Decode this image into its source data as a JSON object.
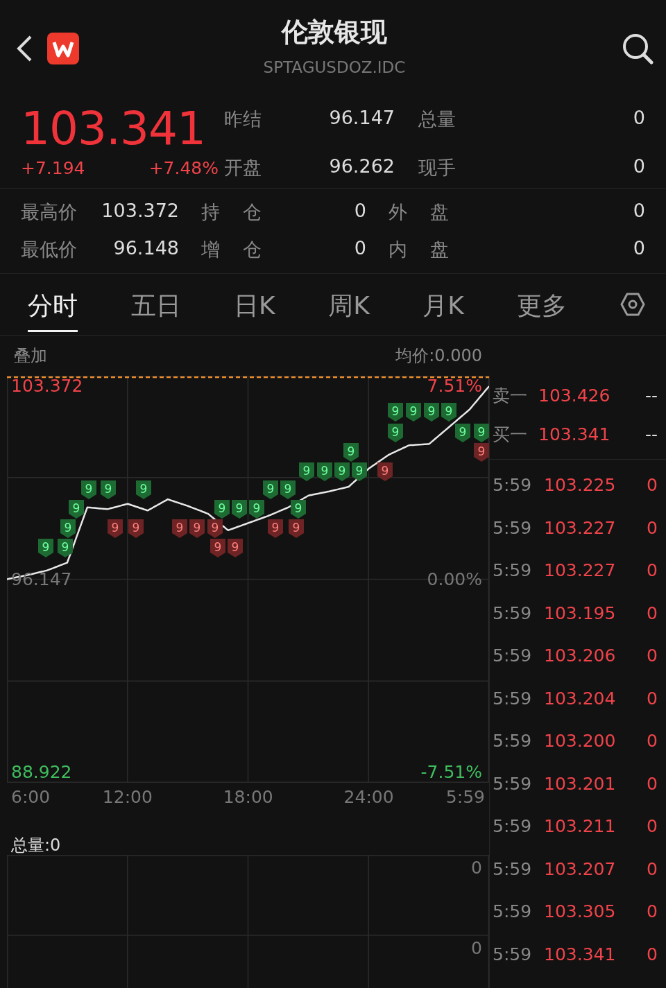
{
  "header": {
    "title": "伦敦银现",
    "code": "SPTAGUSDOZ.IDC"
  },
  "quote": {
    "price": "103.341",
    "change": "+7.194",
    "change_pct": "+7.48%",
    "fields": [
      {
        "label": "昨结",
        "value": "96.147"
      },
      {
        "label": "总量",
        "value": "0"
      },
      {
        "label": "开盘",
        "value": "96.262"
      },
      {
        "label": "现手",
        "value": "0"
      }
    ]
  },
  "stats": [
    {
      "label": "最高价",
      "value": "103.372"
    },
    {
      "label": "持 仓",
      "value": "0"
    },
    {
      "label": "外 盘",
      "value": "0"
    },
    {
      "label": "最低价",
      "value": "96.148"
    },
    {
      "label": "增 仓",
      "value": "0"
    },
    {
      "label": "内 盘",
      "value": "0"
    }
  ],
  "tabs": [
    {
      "label": "分时",
      "selected": true
    },
    {
      "label": "五日",
      "selected": false
    },
    {
      "label": "日K",
      "selected": false
    },
    {
      "label": "周K",
      "selected": false
    },
    {
      "label": "月K",
      "selected": false
    },
    {
      "label": "更多",
      "selected": false
    }
  ],
  "chart": {
    "overlay": "叠加",
    "average": "均价:0.000",
    "top_pct": "7.51%",
    "mid_pct": "0.00%",
    "bottom_pct": "-7.51%",
    "end_time": "5:59",
    "chart_data": {
      "type": "line",
      "x": [
        6,
        7,
        8,
        9,
        10,
        11,
        12,
        13,
        14,
        15,
        16,
        17,
        18,
        19,
        20,
        21,
        22,
        23,
        24,
        25,
        26,
        27,
        28,
        29,
        29.983
      ],
      "series": [
        {
          "color": "#e8e8e8",
          "values": [
            96.15,
            96.3,
            96.48,
            96.77,
            98.84,
            98.77,
            98.97,
            98.72,
            99.14,
            98.89,
            98.6,
            97.98,
            98.25,
            98.52,
            98.84,
            99.28,
            99.43,
            99.61,
            100.29,
            100.81,
            101.16,
            101.21,
            101.85,
            102.49,
            103.37
          ]
        }
      ],
      "ylim": [
        88.533,
        103.761
      ],
      "grid": true,
      "yticks": [
        {
          "value": 88.922,
          "label": "88.922"
        },
        {
          "value": 96.147,
          "label": "96.147"
        },
        {
          "value": 103.372,
          "label": "103.372"
        }
      ],
      "xlim": [
        6,
        29.983
      ],
      "xticks": [
        {
          "value": 6,
          "label": "6:00"
        },
        {
          "value": 12,
          "label": "12:00"
        },
        {
          "value": 18,
          "label": "18:00"
        },
        {
          "value": 24,
          "label": "24:00"
        }
      ]
    },
    "markers": [
      {
        "label": "9",
        "color": "#1d6b32"
      },
      {
        "label": "9",
        "color": "#1d6b32"
      },
      {
        "label": "9",
        "color": "#1d6b32"
      },
      {
        "label": "9",
        "color": "#1d6b32"
      },
      {
        "label": "9",
        "color": "#1d6b32"
      },
      {
        "label": "9",
        "color": "#1d6b32"
      },
      {
        "label": "9",
        "color": "#1d6b32"
      },
      {
        "label": "9",
        "color": "#1d6b32"
      },
      {
        "label": "9",
        "color": "#6e2424"
      },
      {
        "label": "9",
        "color": "#1d6b32"
      },
      {
        "label": "9",
        "color": "#1d6b32"
      },
      {
        "label": "9",
        "color": "#1d6b32"
      },
      {
        "label": "9",
        "color": "#1d6b32"
      },
      {
        "label": "9",
        "color": "#6e2424"
      },
      {
        "label": "9",
        "color": "#1d6b32"
      },
      {
        "label": "9",
        "color": "#1d6b32"
      },
      {
        "label": "9",
        "color": "#1d6b32"
      },
      {
        "label": "9",
        "color": "#1d6b32"
      },
      {
        "label": "9",
        "color": "#1d6b32"
      },
      {
        "label": "9",
        "color": "#1d6b32"
      },
      {
        "label": "9",
        "color": "#1d6b32"
      },
      {
        "label": "9",
        "color": "#1d6b32"
      },
      {
        "label": "9",
        "color": "#1d6b32"
      },
      {
        "label": "9",
        "color": "#1d6b32"
      },
      {
        "label": "9",
        "color": "#1d6b32"
      },
      {
        "label": "9",
        "color": "#6e2424"
      },
      {
        "label": "9",
        "color": "#6e2424"
      },
      {
        "label": "9",
        "color": "#6e2424"
      },
      {
        "label": "9",
        "color": "#6e2424"
      },
      {
        "label": "9",
        "color": "#6e2424"
      },
      {
        "label": "9",
        "color": "#6e2424"
      },
      {
        "label": "9",
        "color": "#6e2424"
      },
      {
        "label": "9",
        "color": "#1d6b32"
      },
      {
        "label": "9",
        "color": "#1d6b32"
      },
      {
        "label": "9",
        "color": "#6e2424"
      },
      {
        "label": "9",
        "color": "#6e2424"
      }
    ]
  },
  "volume": {
    "label": "总量:0",
    "axis_labels": [
      "0",
      "0"
    ]
  },
  "order_book": [
    {
      "label": "卖一",
      "price": "103.426",
      "volume": "--"
    },
    {
      "label": "买一",
      "price": "103.341",
      "volume": "--"
    }
  ],
  "trades": [
    {
      "time": "5:59",
      "price": "103.225",
      "volume": "0"
    },
    {
      "time": "5:59",
      "price": "103.227",
      "volume": "0"
    },
    {
      "time": "5:59",
      "price": "103.227",
      "volume": "0"
    },
    {
      "time": "5:59",
      "price": "103.195",
      "volume": "0"
    },
    {
      "time": "5:59",
      "price": "103.206",
      "volume": "0"
    },
    {
      "time": "5:59",
      "price": "103.204",
      "volume": "0"
    },
    {
      "time": "5:59",
      "price": "103.200",
      "volume": "0"
    },
    {
      "time": "5:59",
      "price": "103.201",
      "volume": "0"
    },
    {
      "time": "5:59",
      "price": "103.211",
      "volume": "0"
    },
    {
      "time": "5:59",
      "price": "103.207",
      "volume": "0"
    },
    {
      "time": "5:59",
      "price": "103.305",
      "volume": "0"
    },
    {
      "time": "5:59",
      "price": "103.341",
      "volume": "0"
    }
  ]
}
